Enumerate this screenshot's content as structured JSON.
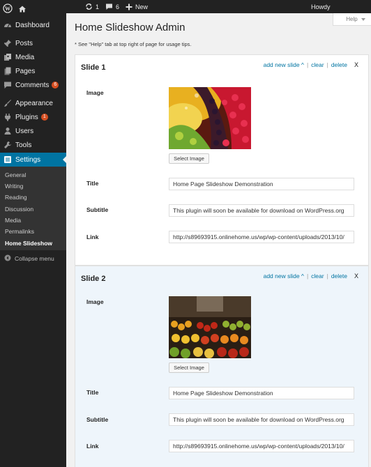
{
  "adminbar": {
    "updates_count": "1",
    "comments_count": "6",
    "new_label": "New",
    "howdy_label": "Howdy"
  },
  "sidebar": {
    "items": [
      {
        "label": "Dashboard",
        "icon": "dashboard-icon"
      },
      {
        "label": "Posts",
        "icon": "pin-icon"
      },
      {
        "label": "Media",
        "icon": "media-icon"
      },
      {
        "label": "Pages",
        "icon": "pages-icon"
      },
      {
        "label": "Comments",
        "icon": "comment-icon",
        "badge": "6"
      },
      {
        "label": "Appearance",
        "icon": "brush-icon"
      },
      {
        "label": "Plugins",
        "icon": "plugin-icon",
        "badge": "1"
      },
      {
        "label": "Users",
        "icon": "user-icon"
      },
      {
        "label": "Tools",
        "icon": "wrench-icon"
      },
      {
        "label": "Settings",
        "icon": "settings-icon"
      }
    ],
    "submenu": [
      "General",
      "Writing",
      "Reading",
      "Discussion",
      "Media",
      "Permalinks",
      "Home Slideshow"
    ],
    "collapse_label": "Collapse menu"
  },
  "help_label": "Help",
  "page": {
    "title": "Home Slideshow Admin",
    "note": "* See \"Help\" tab at top right of page for usage tips."
  },
  "slide_actions": {
    "add": "add new slide ^",
    "sep": "|",
    "clear": "clear",
    "delete": "delete",
    "close": "X"
  },
  "field_labels": {
    "image": "Image",
    "title": "Title",
    "subtitle": "Subtitle",
    "link": "Link",
    "select_image": "Select Image"
  },
  "slides": [
    {
      "heading": "Slide 1",
      "title": "Home Page Slideshow Demonstration",
      "subtitle": "This plugin will soon be available for download on WordPress.org",
      "link": "http://s89693915.onlinehome.us/wp/wp-content/uploads/2013/10/",
      "image": "fruit-platter-image"
    },
    {
      "heading": "Slide 2",
      "title": "Home Page Slideshow Demonstration",
      "subtitle": "This plugin will soon be available for download on WordPress.org",
      "link": "http://s89693915.onlinehome.us/wp/wp-content/uploads/2013/10/",
      "image": "fruit-market-image"
    }
  ],
  "colors": {
    "adminbar": "#222222",
    "accent": "#0074a2",
    "badge": "#d54e21",
    "slide2_bg": "#eef5fb"
  }
}
